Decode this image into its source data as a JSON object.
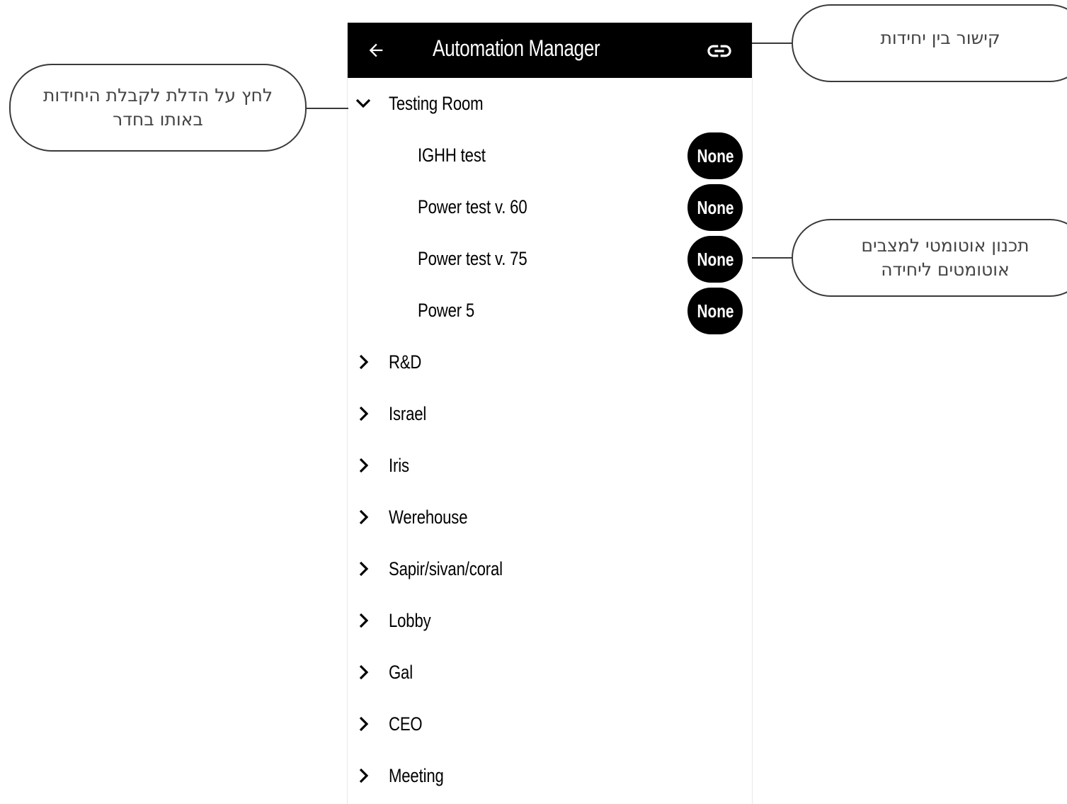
{
  "app_bar": {
    "title": "Automation Manager",
    "back_icon": "arrow-left-icon",
    "link_icon": "link-icon"
  },
  "rooms": [
    {
      "name": "Testing Room",
      "expanded": true,
      "units": [
        {
          "name": "IGHH test",
          "mode": "None"
        },
        {
          "name": "Power test v. 60",
          "mode": "None"
        },
        {
          "name": "Power test v. 75",
          "mode": "None"
        },
        {
          "name": "Power 5",
          "mode": "None"
        }
      ]
    },
    {
      "name": "R&D",
      "expanded": false
    },
    {
      "name": "Israel",
      "expanded": false
    },
    {
      "name": "Iris",
      "expanded": false
    },
    {
      "name": "Werehouse",
      "expanded": false
    },
    {
      "name": "Sapir/sivan/coral",
      "expanded": false
    },
    {
      "name": "Lobby",
      "expanded": false
    },
    {
      "name": "Gal",
      "expanded": false
    },
    {
      "name": "CEO",
      "expanded": false
    },
    {
      "name": "Meeting",
      "expanded": false
    }
  ],
  "annotations": {
    "link_units": "קישור בין יחידות",
    "expand_room": "לחץ על הדלת לקבלת היחידות באותו בחדר",
    "auto_planning": "תכנון אוטומטי למצבים אוטומטים ליחידה"
  },
  "colors": {
    "app_bar_bg": "#000000",
    "pill_bg": "#000000",
    "pill_text": "#ffffff",
    "callout_border": "#3a3a3a"
  }
}
